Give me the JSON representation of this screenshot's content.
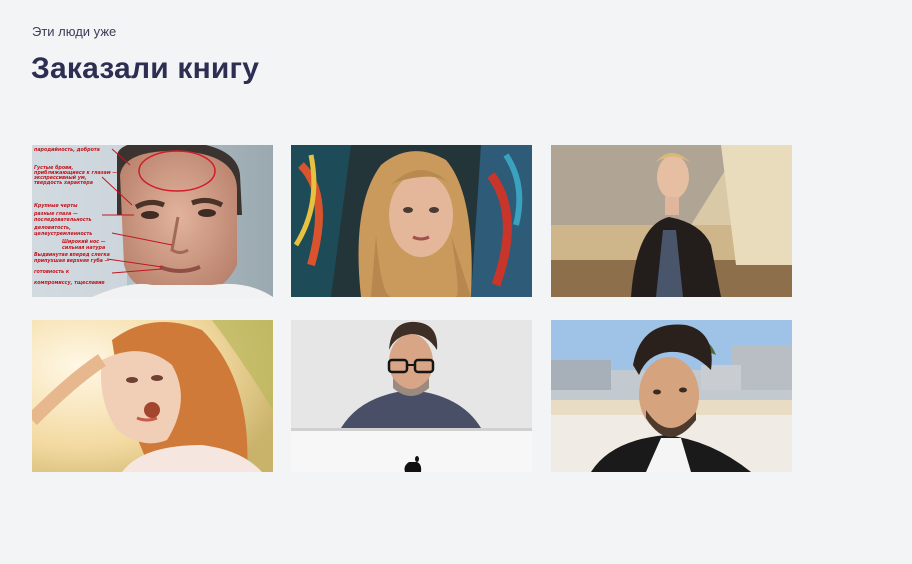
{
  "section": {
    "subtitle": "Эти люди уже",
    "title": "Заказали книгу"
  },
  "photos": [
    {
      "subject": "man-face-annotated",
      "notes": [
        "пародийность, доброта",
        "Густые брови,",
        "приближающиеся к глазам —",
        "экспрессивный ум,",
        "твердость характера",
        "Крупные черты",
        "разные глаза —",
        "последовательность",
        "деловитость,",
        "целеустремленность",
        "Широкий нос —",
        "сильная натура",
        "Выдвинутая вперед слегка",
        "припухшая верхняя губа —",
        "готовность к",
        "компромиссу, тщеславие"
      ]
    },
    {
      "subject": "woman-blonde-graffiti"
    },
    {
      "subject": "young-man-leather-jacket"
    },
    {
      "subject": "woman-redhead-sunlight"
    },
    {
      "subject": "man-glasses-laptop"
    },
    {
      "subject": "man-styled-hair-beach"
    }
  ]
}
